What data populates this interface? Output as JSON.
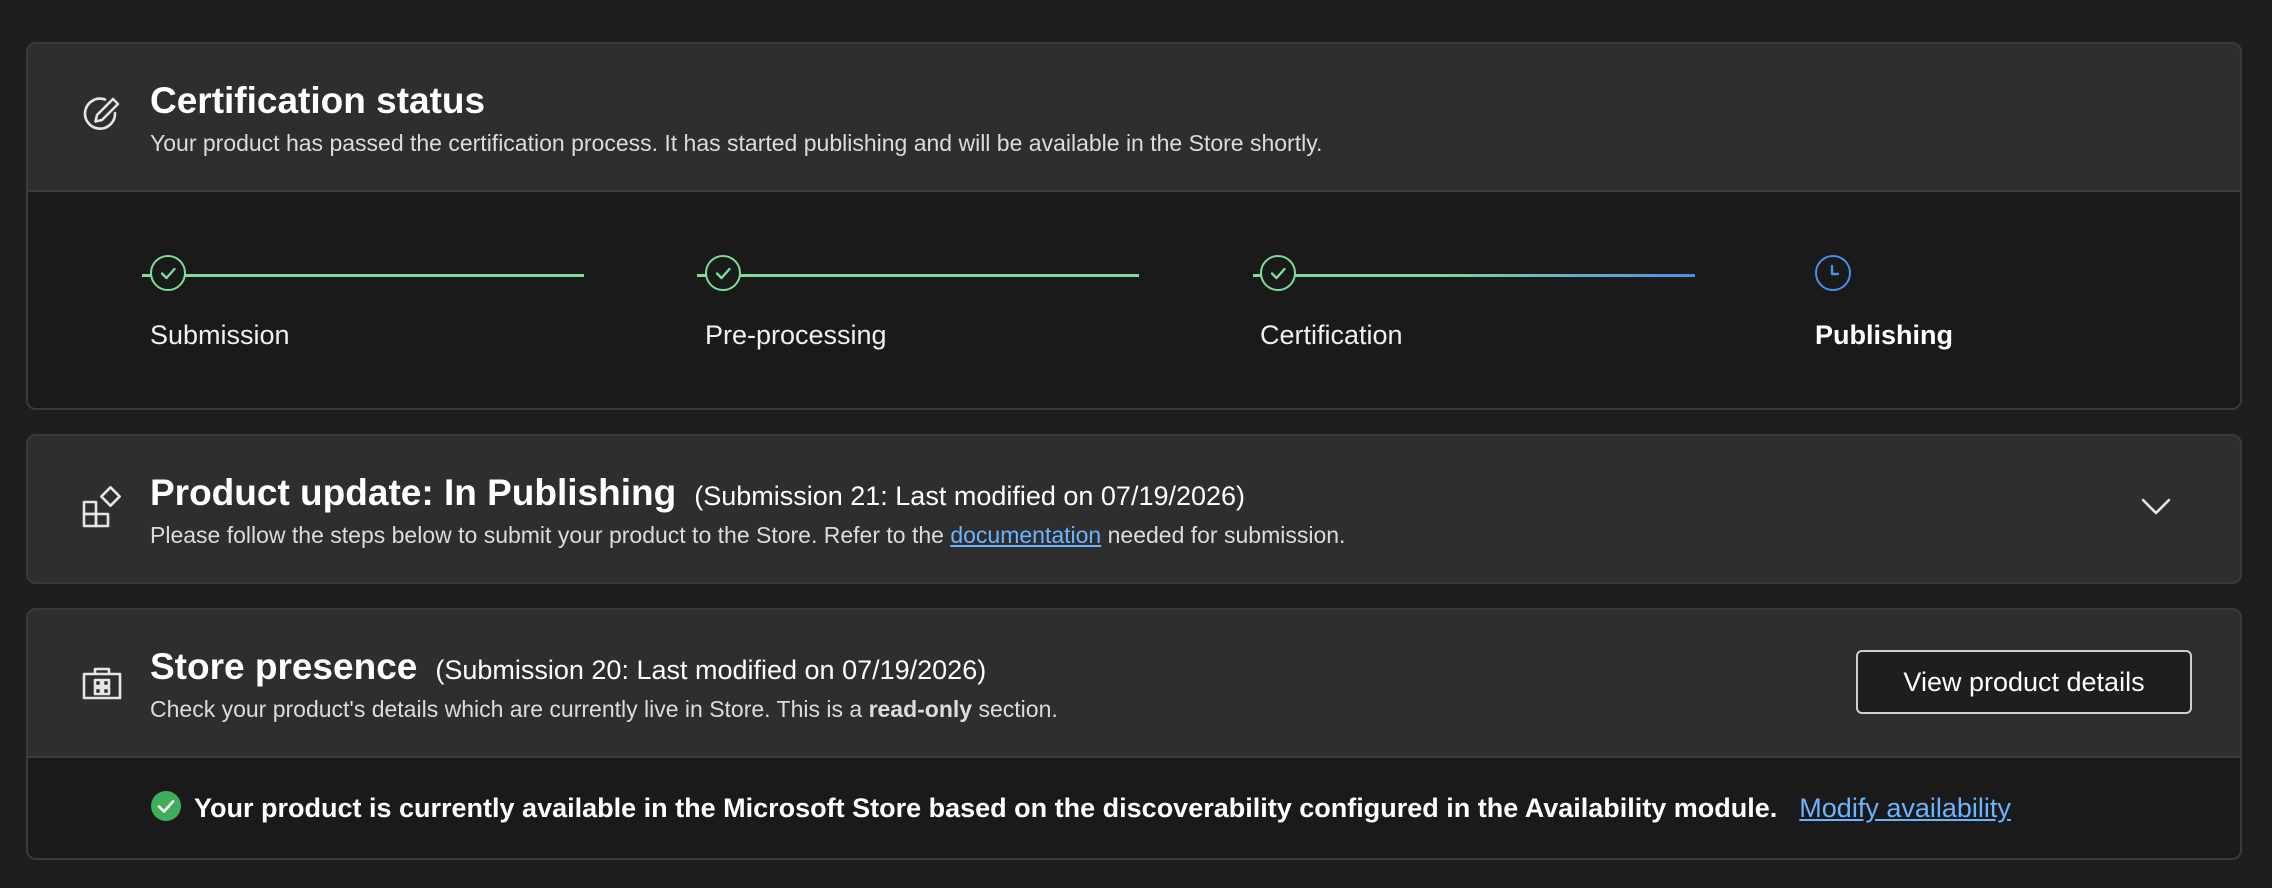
{
  "certification": {
    "title": "Certification status",
    "subtitle": "Your product has passed the certification process. It has started publishing and will be available in the Store shortly.",
    "icon": "edit-pencil-icon",
    "steps": [
      {
        "label": "Submission",
        "status": "complete"
      },
      {
        "label": "Pre-processing",
        "status": "complete"
      },
      {
        "label": "Certification",
        "status": "complete"
      },
      {
        "label": "Publishing",
        "status": "in-progress"
      }
    ]
  },
  "product_update": {
    "title": "Product update: In Publishing",
    "meta": "(Submission 21: Last modified on 07/19/2026)",
    "subtitle_before": "Please follow the steps below to submit your product to the Store. Refer to the",
    "link_text": "documentation",
    "subtitle_after": "needed for submission.",
    "icon": "app-grid-icon",
    "expand_icon": "chevron-down-icon"
  },
  "store_presence": {
    "title": "Store presence",
    "meta": "(Submission 20: Last modified on 07/19/2026)",
    "subtitle_before": "Check your product's details which are currently live in Store. This is a",
    "subtitle_bold": "read-only",
    "subtitle_after": "section.",
    "button_label": "View product details",
    "icon": "store-bag-icon",
    "availability_text": "Your product is currently available in the Microsoft Store based on the discoverability configured in the Availability module.",
    "availability_link": "Modify availability"
  },
  "colors": {
    "complete": "#7ddc9a",
    "pending": "#4a8fe8",
    "link": "#6cb4ff",
    "success": "#3fae5a"
  }
}
